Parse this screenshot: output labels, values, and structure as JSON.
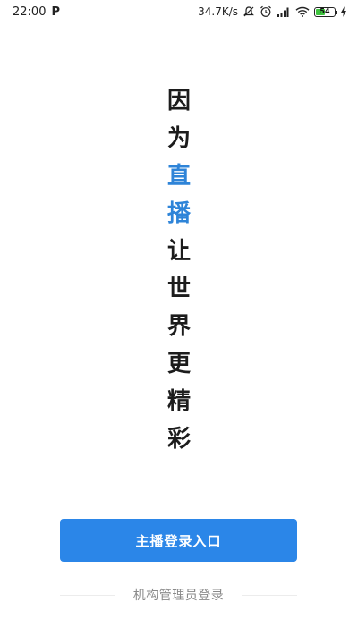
{
  "status_bar": {
    "time": "22:00",
    "app_badge": "P",
    "network_speed": "34.7K/s",
    "battery_level": "54",
    "battery_fraction": 0.54,
    "icons": [
      "mute-icon",
      "alarm-icon",
      "signal-icon",
      "wifi-icon",
      "battery-icon",
      "charging-icon"
    ]
  },
  "slogan": {
    "chars": [
      {
        "text": "因",
        "highlight": false
      },
      {
        "text": "为",
        "highlight": false
      },
      {
        "text": "直",
        "highlight": true
      },
      {
        "text": "播",
        "highlight": true
      },
      {
        "text": "让",
        "highlight": false
      },
      {
        "text": "世",
        "highlight": false
      },
      {
        "text": "界",
        "highlight": false
      },
      {
        "text": "更",
        "highlight": false
      },
      {
        "text": "精",
        "highlight": false
      },
      {
        "text": "彩",
        "highlight": false
      }
    ]
  },
  "actions": {
    "host_login_label": "主播登录入口",
    "admin_login_label": "机构管理员登录"
  },
  "colors": {
    "accent": "#2b86e8",
    "highlight_text": "#2e84d8",
    "secondary_text": "#8a8a8a"
  }
}
